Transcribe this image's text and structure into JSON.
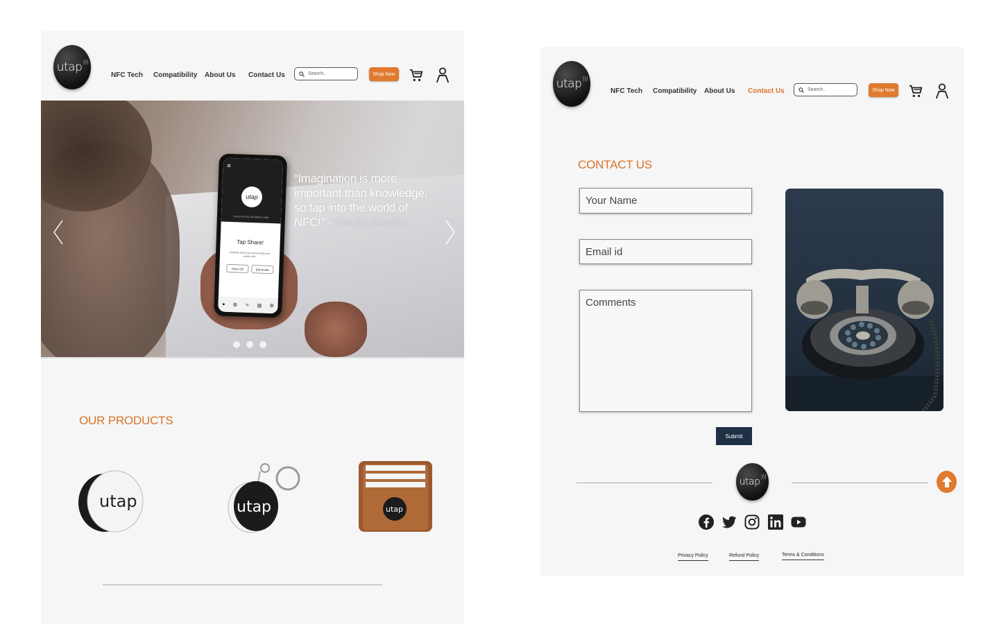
{
  "brand": {
    "logo_text": "utap",
    "accent": "#d9732a",
    "button": "#e07a2e",
    "dark_button": "#1f2f45"
  },
  "nav": {
    "links": [
      "NFC  Tech",
      "Compatibility",
      "About Us",
      "Contact Us"
    ],
    "search_placeholder": "Search..",
    "shop_label": "Shop Now",
    "cart_icon": "cart-icon",
    "user_icon": "user-icon"
  },
  "home": {
    "hero": {
      "quote": "“Imagination is more important than knowledge, so tap into the world of NFC!” - ",
      "author": "Honibi Studios",
      "slides": 3,
      "phone": {
        "logo": "utap",
        "subtitle": "YOUR DIGITAL BUSINESS CARD",
        "tap_text": "Tap  Share!",
        "desc": "Instantly share your social media and contact info.",
        "btn1": "Direct Off",
        "btn2": "Edit Profile"
      }
    },
    "products_title": "OUR PRODUCTS",
    "products": [
      "nfc-tag-disc",
      "nfc-keychain",
      "nfc-card-wallet"
    ]
  },
  "contact": {
    "title": "CONTACT US",
    "name_placeholder": "Your Name",
    "email_placeholder": "Email id",
    "comments_placeholder": "Comments",
    "submit_label": "Submit",
    "footer": {
      "social": [
        "facebook-icon",
        "twitter-icon",
        "instagram-icon",
        "linkedin-icon",
        "youtube-icon"
      ],
      "links": [
        "Privacy Policy",
        "Refund Policy",
        "Terms & Conditions"
      ]
    }
  }
}
